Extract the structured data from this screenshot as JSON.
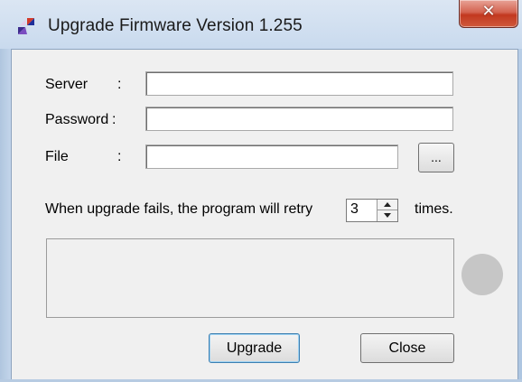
{
  "window": {
    "title": "Upgrade Firmware Version 1.255",
    "close_glyph": "✕",
    "icon": "app-logo-icon"
  },
  "form": {
    "server_label": "Server",
    "server_colon": ":",
    "server_value": "",
    "password_label": "Password",
    "password_colon": ":",
    "password_value": "",
    "file_label": "File",
    "file_colon": ":",
    "file_value": "",
    "browse_label": "..."
  },
  "retry": {
    "prefix": "When upgrade fails, the program will retry",
    "count": "3",
    "suffix": "times."
  },
  "status": {
    "text": ""
  },
  "buttons": {
    "upgrade_label": "Upgrade",
    "close_label": "Close"
  },
  "colors": {
    "titlebar": "#c9daee",
    "client_bg": "#f0f0f0",
    "close_button": "#c2381f",
    "indicator_idle": "#c6c6c6"
  }
}
